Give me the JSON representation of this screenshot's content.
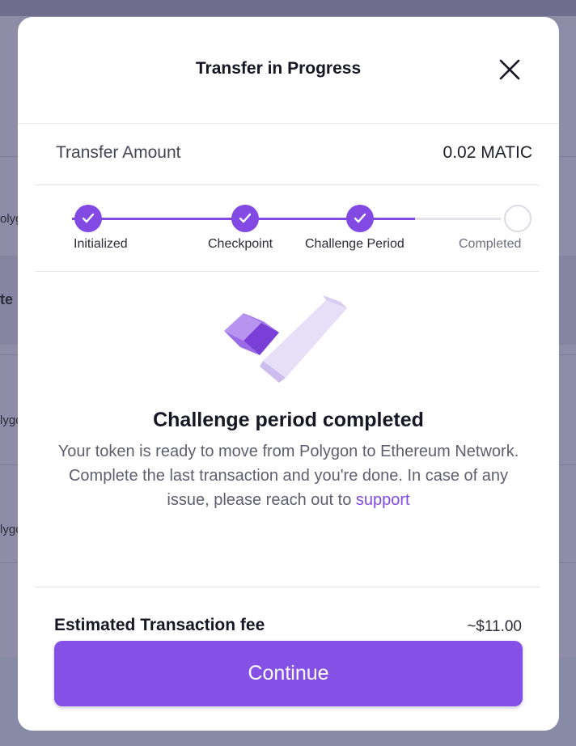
{
  "background": {
    "row_fragments": [
      "olyg",
      "te",
      "lygo",
      "lygo"
    ]
  },
  "modal": {
    "title": "Transfer in Progress",
    "close_icon": "close-icon",
    "transfer": {
      "label": "Transfer Amount",
      "value": "0.02 MATIC"
    },
    "steps": [
      {
        "label": "Initialized",
        "status": "done"
      },
      {
        "label": "Checkpoint",
        "status": "done"
      },
      {
        "label": "Challenge Period",
        "status": "done"
      },
      {
        "label": "Completed",
        "status": "pending"
      }
    ],
    "progress_fraction": 0.8,
    "illustration_icon": "checkmark-illustration-icon",
    "status_title": "Challenge period completed",
    "status_message": "Your token is ready to move from Polygon to Ethereum Network. Complete the last transaction and you're done. In case of any issue, please reach out to",
    "support_link": "support",
    "fee": {
      "label": "Estimated Transaction fee",
      "value": "~$11.00"
    },
    "continue_label": "Continue"
  },
  "colors": {
    "accent": "#8249e3",
    "button": "#8450e6",
    "overlay": "#8e8ca6"
  }
}
